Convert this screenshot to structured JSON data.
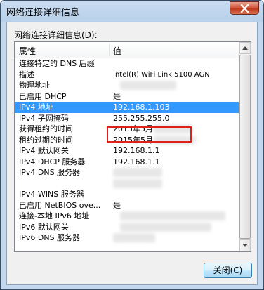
{
  "window": {
    "title": "网络连接详细信息"
  },
  "dialog": {
    "group_label": "网络连接详细信息(D):",
    "columns": {
      "property": "属性",
      "value": "值"
    },
    "rows": [
      {
        "prop": "连接特定的 DNS 后缀",
        "value": ""
      },
      {
        "prop": "描述",
        "value": "Intel(R) WiFi Link 5100 AGN"
      },
      {
        "prop": "物理地址",
        "value": ""
      },
      {
        "prop": "已启用 DHCP",
        "value": "是"
      },
      {
        "prop": "IPv4 地址",
        "value": "192.168.1.103"
      },
      {
        "prop": "IPv4 子网掩码",
        "value": "255.255.255.0"
      },
      {
        "prop": "获得租约的时间",
        "value": "2015年5月"
      },
      {
        "prop": "租约过期的时间",
        "value": "2015年5月"
      },
      {
        "prop": "IPv4 默认网关",
        "value": "192.168.1.1"
      },
      {
        "prop": "IPv4 DHCP 服务器",
        "value": "192.168.1.1"
      },
      {
        "prop": "IPv4 DNS 服务器",
        "value": ""
      },
      {
        "prop": "",
        "value": ""
      },
      {
        "prop": "IPv4 WINS 服务器",
        "value": ""
      },
      {
        "prop": "已启用 NetBIOS ove...",
        "value": "是"
      },
      {
        "prop": "连接-本地 IPv6 地址",
        "value": ""
      },
      {
        "prop": "IPv6 默认网关",
        "value": ""
      },
      {
        "prop": "IPv6 DNS 服务器",
        "value": ""
      }
    ],
    "close_button_label": "关闭(C)"
  },
  "colors": {
    "selection": "#3399ff",
    "highlight_box": "#e0201c"
  },
  "icons": {
    "title_close": "close-icon"
  }
}
